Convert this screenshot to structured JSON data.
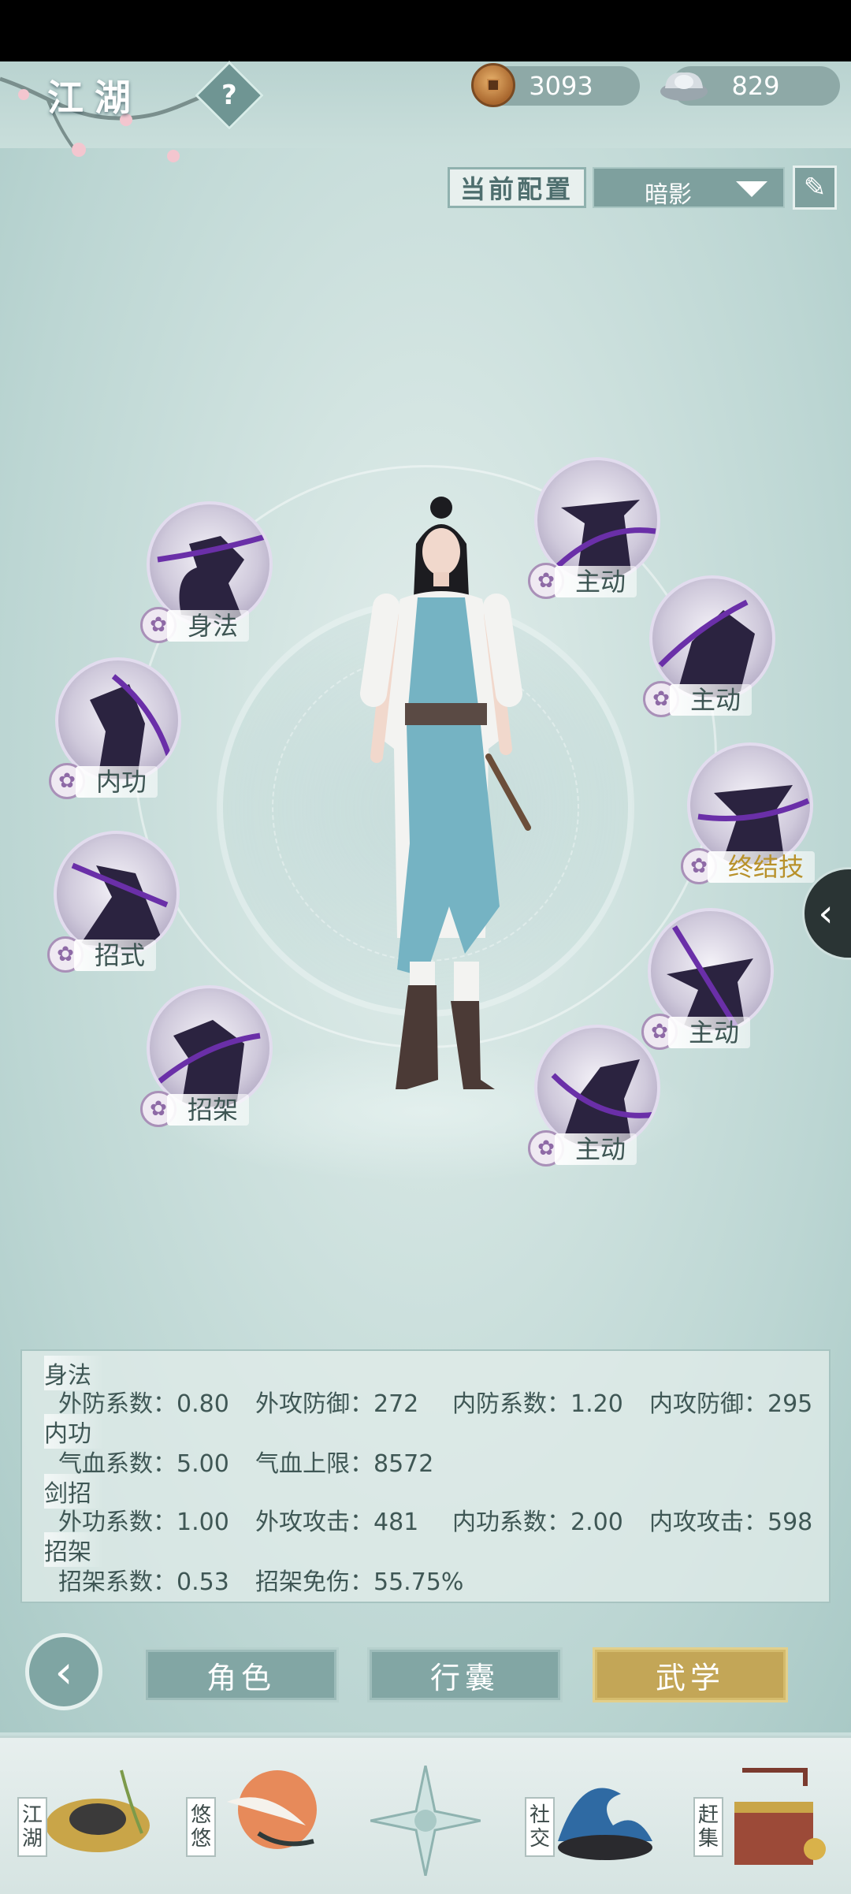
{
  "header": {
    "title": "江湖",
    "help_icon": "?",
    "copper": "3093",
    "silver": "829"
  },
  "config": {
    "label": "当前配置",
    "selected": "暗影",
    "edit_icon": "✎"
  },
  "skills": {
    "left": [
      {
        "label": "身法"
      },
      {
        "label": "内功"
      },
      {
        "label": "招式"
      },
      {
        "label": "招架"
      }
    ],
    "right": [
      {
        "label": "主动"
      },
      {
        "label": "主动"
      },
      {
        "label": "终结技"
      },
      {
        "label": "主动"
      },
      {
        "label": "主动"
      }
    ]
  },
  "side_arrow": "‹",
  "stats": {
    "sections": [
      {
        "title": "身法",
        "items": [
          "外防系数：0.80",
          "外攻防御：272",
          "内防系数：1.20",
          "内攻防御：295"
        ]
      },
      {
        "title": "内功",
        "items": [
          "气血系数：5.00",
          "气血上限：8572"
        ]
      },
      {
        "title": "剑招",
        "items": [
          "外功系数：1.00",
          "外攻攻击：481",
          "内功系数：2.00",
          "内攻攻击：598"
        ]
      },
      {
        "title": "招架",
        "items": [
          "招架系数：0.53",
          "招架免伤：55.75%"
        ]
      }
    ]
  },
  "tabs": {
    "back_icon": "‹",
    "role": "角色",
    "bag": "行囊",
    "martial": "武学",
    "active": "martial"
  },
  "bottom_nav": {
    "jianghu": "江湖",
    "youyou": "悠悠",
    "social": "社交",
    "market": "赶集"
  },
  "colors": {
    "accent_gold": "#c3a657",
    "tab_teal": "#82a6a4",
    "skill_purple": "#6a2fa8"
  }
}
